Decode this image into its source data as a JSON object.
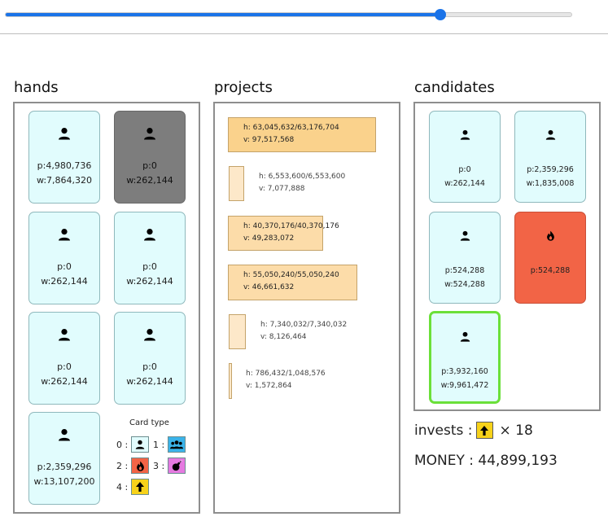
{
  "slider": {
    "value_fraction": 0.767
  },
  "sections": {
    "hands": "hands",
    "projects": "projects",
    "candidates": "candidates"
  },
  "hands": [
    {
      "type": "person",
      "p": "p:4,980,736",
      "w": "w:7,864,320",
      "state": "normal"
    },
    {
      "type": "person",
      "p": "p:0",
      "w": "w:262,144",
      "state": "gray"
    },
    {
      "type": "person",
      "p": "p:0",
      "w": "w:262,144",
      "state": "normal"
    },
    {
      "type": "person",
      "p": "p:0",
      "w": "w:262,144",
      "state": "normal"
    },
    {
      "type": "person",
      "p": "p:0",
      "w": "w:262,144",
      "state": "normal"
    },
    {
      "type": "person",
      "p": "p:0",
      "w": "w:262,144",
      "state": "normal"
    },
    {
      "type": "person",
      "p": "p:2,359,296",
      "w": "w:13,107,200",
      "state": "normal"
    }
  ],
  "legend": {
    "title": "Card type",
    "items": [
      {
        "label": "0 :",
        "icon": "person-icon",
        "color": "#e1fcfd"
      },
      {
        "label": "1 :",
        "icon": "group-icon",
        "color": "#3ab3ea"
      },
      {
        "label": "2 :",
        "icon": "fire-icon",
        "color": "#f26446"
      },
      {
        "label": "3 :",
        "icon": "bomb-icon",
        "color": "#e57ae0"
      },
      {
        "label": "4 :",
        "icon": "arrow-up-icon",
        "color": "#f7d21a"
      }
    ]
  },
  "projects": [
    {
      "h": "h: 63,045,632/63,176,704",
      "v": "v: 97,517,568",
      "fill": 0.998
    },
    {
      "h": "h: 6,553,600/6,553,600",
      "v": "v: 7,077,888",
      "fill": 1.0
    },
    {
      "h": "h: 40,370,176/40,370,176",
      "v": "v: 49,283,072",
      "fill": 1.0
    },
    {
      "h": "h: 55,050,240/55,050,240",
      "v": "v: 46,661,632",
      "fill": 1.0
    },
    {
      "h": "h: 7,340,032/7,340,032",
      "v": "v: 8,126,464",
      "fill": 1.0
    },
    {
      "h": "h: 786,432/1,048,576",
      "v": "v: 1,572,864",
      "fill": 0.75
    }
  ],
  "candidates": [
    {
      "type": "person",
      "p": "p:0",
      "w": "w:262,144",
      "state": "normal"
    },
    {
      "type": "person",
      "p": "p:2,359,296",
      "w": "w:1,835,008",
      "state": "normal"
    },
    {
      "type": "person",
      "p": "p:524,288",
      "w": "w:524,288",
      "state": "normal"
    },
    {
      "type": "fire",
      "p": "p:524,288",
      "w": "",
      "state": "fire"
    },
    {
      "type": "person",
      "p": "p:3,932,160",
      "w": "w:9,961,472",
      "state": "selected"
    }
  ],
  "invests": {
    "label": "invests :",
    "icon": "arrow-up-icon",
    "count": "× 18"
  },
  "money": {
    "text": "MONEY : 44,899,193"
  }
}
